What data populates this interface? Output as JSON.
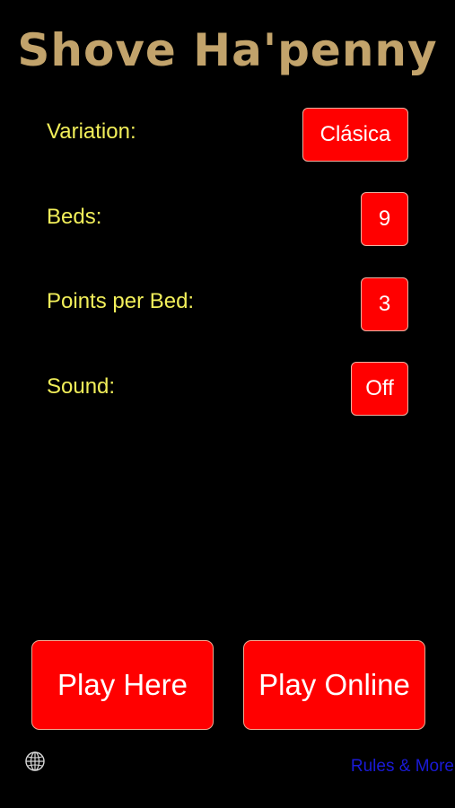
{
  "app": {
    "title": "Shove Ha'penny"
  },
  "settings": {
    "variation": {
      "label": "Variation:",
      "value": "Clásica"
    },
    "beds": {
      "label": "Beds:",
      "value": "9"
    },
    "points_per_bed": {
      "label": "Points per Bed:",
      "value": "3"
    },
    "sound": {
      "label": "Sound:",
      "value": "Off"
    }
  },
  "actions": {
    "play_here": "Play Here",
    "play_online": "Play Online"
  },
  "footer": {
    "globe_icon": "globe-icon",
    "rules_link": "Rules & More"
  },
  "colors": {
    "background": "#000000",
    "title": "#c2a36b",
    "label": "#f2ef5a",
    "button": "#ff0000",
    "link": "#1a1ad6"
  }
}
